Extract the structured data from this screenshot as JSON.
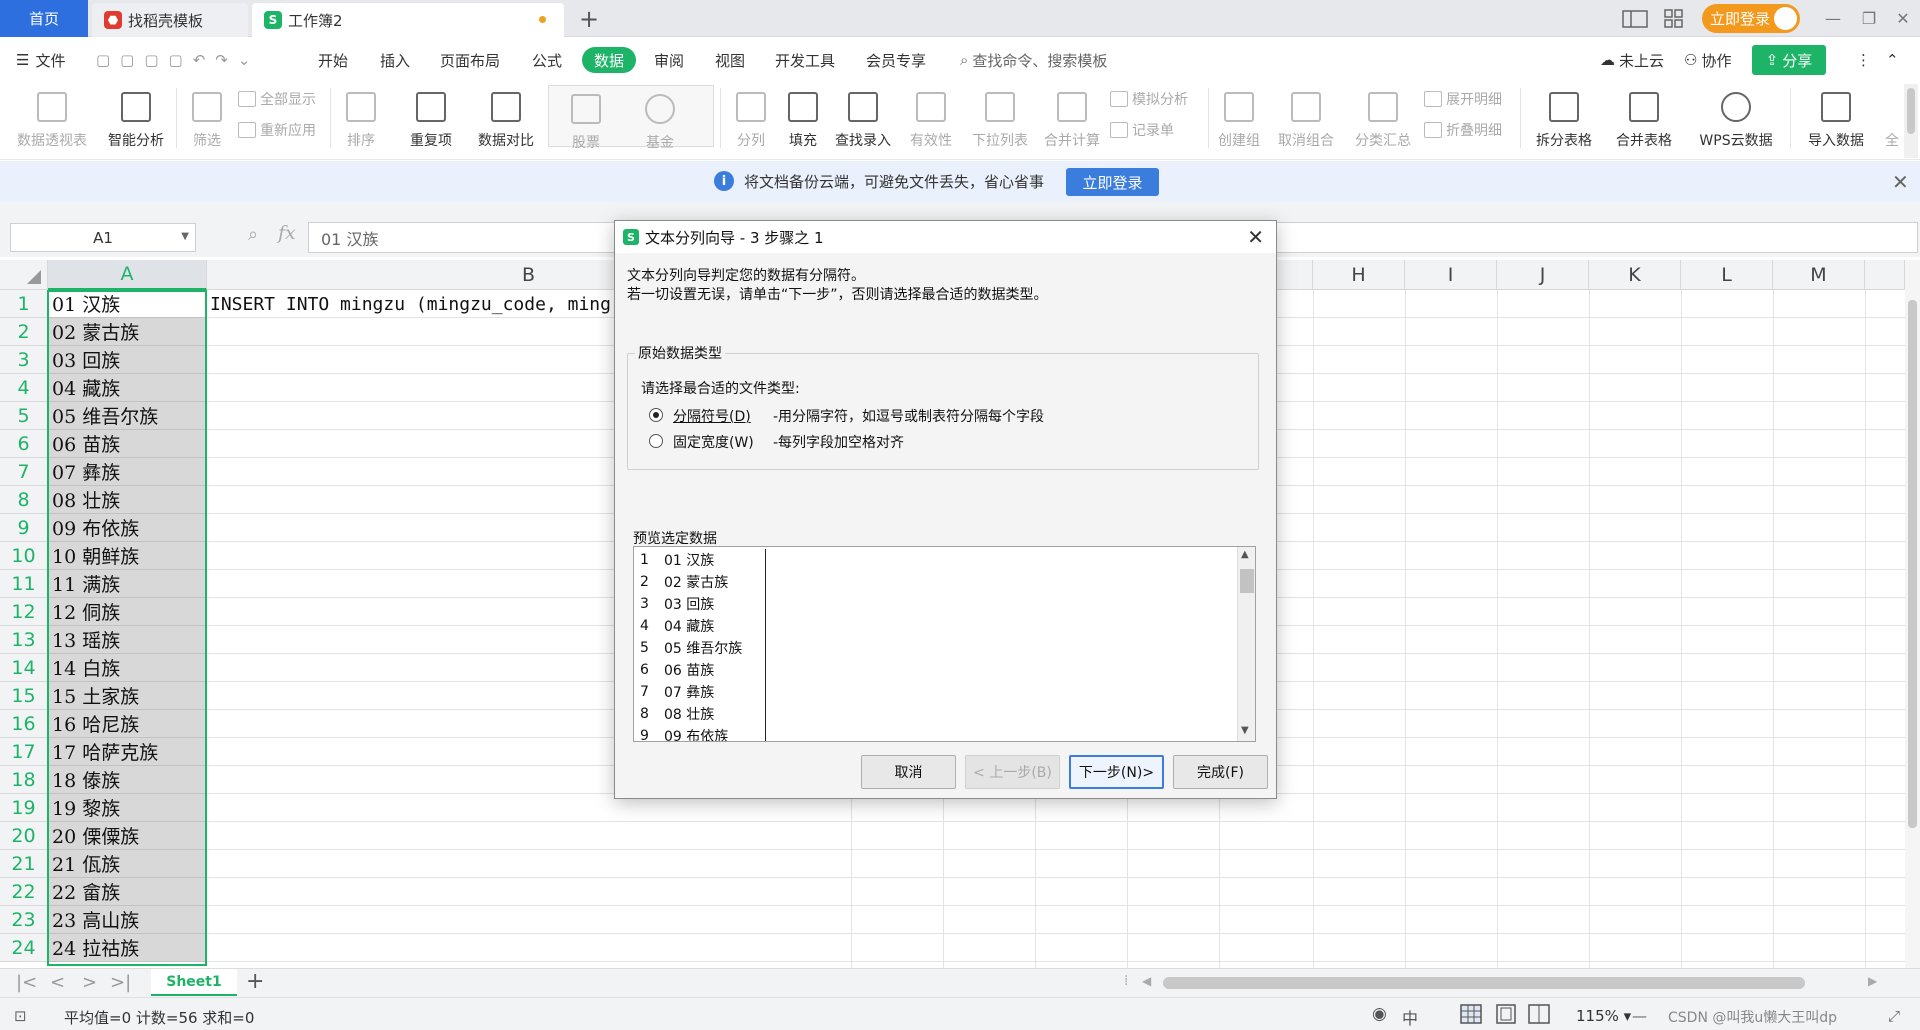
{
  "titlebar": {
    "home_tab": "首页",
    "template_tab": "找稻壳模板",
    "workbook_tab": "工作簿2",
    "login_button": "立即登录"
  },
  "menu": {
    "file": "文件",
    "items": [
      "开始",
      "插入",
      "页面布局",
      "公式",
      "数据",
      "审阅",
      "视图",
      "开发工具",
      "会员专享"
    ],
    "active": "数据",
    "search": "查找命令、搜索模板",
    "cloud": "未上云",
    "collab": "协作",
    "share": "分享"
  },
  "ribbon": {
    "pivot": "数据透视表",
    "smart": "智能分析",
    "filter": "筛选",
    "show_all": "全部显示",
    "reapply": "重新应用",
    "sort": "排序",
    "duplicates": "重复项",
    "compare": "数据对比",
    "stock": "股票",
    "fund": "基金",
    "split": "分列",
    "fill": "填充",
    "lookup": "查找录入",
    "validity": "有效性",
    "dropdown": "下拉列表",
    "consolidate": "合并计算",
    "simulate": "模拟分析",
    "record": "记录单",
    "group": "创建组",
    "ungroup": "取消组合",
    "subtotal": "分类汇总",
    "expand": "展开明细",
    "collapse": "折叠明细",
    "split_table": "拆分表格",
    "merge_table": "合并表格",
    "wps_cloud": "WPS云数据",
    "import": "导入数据",
    "more": "全"
  },
  "notify": {
    "text": "将文档备份云端，可避免文件丢失，省心省事",
    "button": "立即登录"
  },
  "formula": {
    "name_box": "A1",
    "fx": "fx",
    "content": "01 汉族"
  },
  "grid": {
    "columns": [
      "A",
      "B",
      "H",
      "I",
      "J",
      "K",
      "L",
      "M"
    ],
    "rows": [
      "1",
      "2",
      "3",
      "4",
      "5",
      "6",
      "7",
      "8",
      "9",
      "10",
      "11",
      "12",
      "13",
      "14",
      "15",
      "16",
      "17",
      "18",
      "19",
      "20",
      "21",
      "22",
      "23",
      "24"
    ],
    "colA": [
      "01 汉族",
      "02 蒙古族",
      "03 回族",
      "04 藏族",
      "05 维吾尔族",
      "06 苗族",
      "07 彝族",
      "08 壮族",
      "09 布依族",
      "10 朝鲜族",
      "11 满族",
      "12 侗族",
      "13 瑶族",
      "14 白族",
      "15 土家族",
      "16 哈尼族",
      "17 哈萨克族",
      "18 傣族",
      "19 黎族",
      "20 傈僳族",
      "21 佤族",
      "22 畲族",
      "23 高山族",
      "24 拉祜族"
    ],
    "b1": "INSERT INTO mingzu (mingzu_code, ming"
  },
  "sheet": {
    "tab": "Sheet1",
    "add": "+"
  },
  "status": {
    "summary": "平均值=0 计数=56 求和=0",
    "zoom": "115%",
    "watermark": "CSDN @叫我u懒大王叫dp"
  },
  "dialog": {
    "title": "文本分列向导 - 3 步骤之 1",
    "line1": "文本分列向导判定您的数据有分隔符。",
    "line2": "若一切设置无误，请单击“下一步”，否则请选择最合适的数据类型。",
    "group_title": "原始数据类型",
    "choose": "请选择最合适的文件类型:",
    "opt1_label": "分隔符号(D)",
    "opt1_desc": "-用分隔字符，如逗号或制表符分隔每个字段",
    "opt2_label": "固定宽度(W)",
    "opt2_desc": "-每列字段加空格对齐",
    "preview_label": "预览选定数据",
    "preview": [
      {
        "n": "1",
        "v": "01 汉族"
      },
      {
        "n": "2",
        "v": "02 蒙古族"
      },
      {
        "n": "3",
        "v": "03 回族"
      },
      {
        "n": "4",
        "v": "04 藏族"
      },
      {
        "n": "5",
        "v": "05 维吾尔族"
      },
      {
        "n": "6",
        "v": "06 苗族"
      },
      {
        "n": "7",
        "v": "07 彝族"
      },
      {
        "n": "8",
        "v": "08 壮族"
      },
      {
        "n": "9",
        "v": "09 布依族"
      }
    ],
    "cancel": "取消",
    "prev": "< 上一步(B)",
    "next": "下一步(N)>",
    "finish": "完成(F)"
  }
}
